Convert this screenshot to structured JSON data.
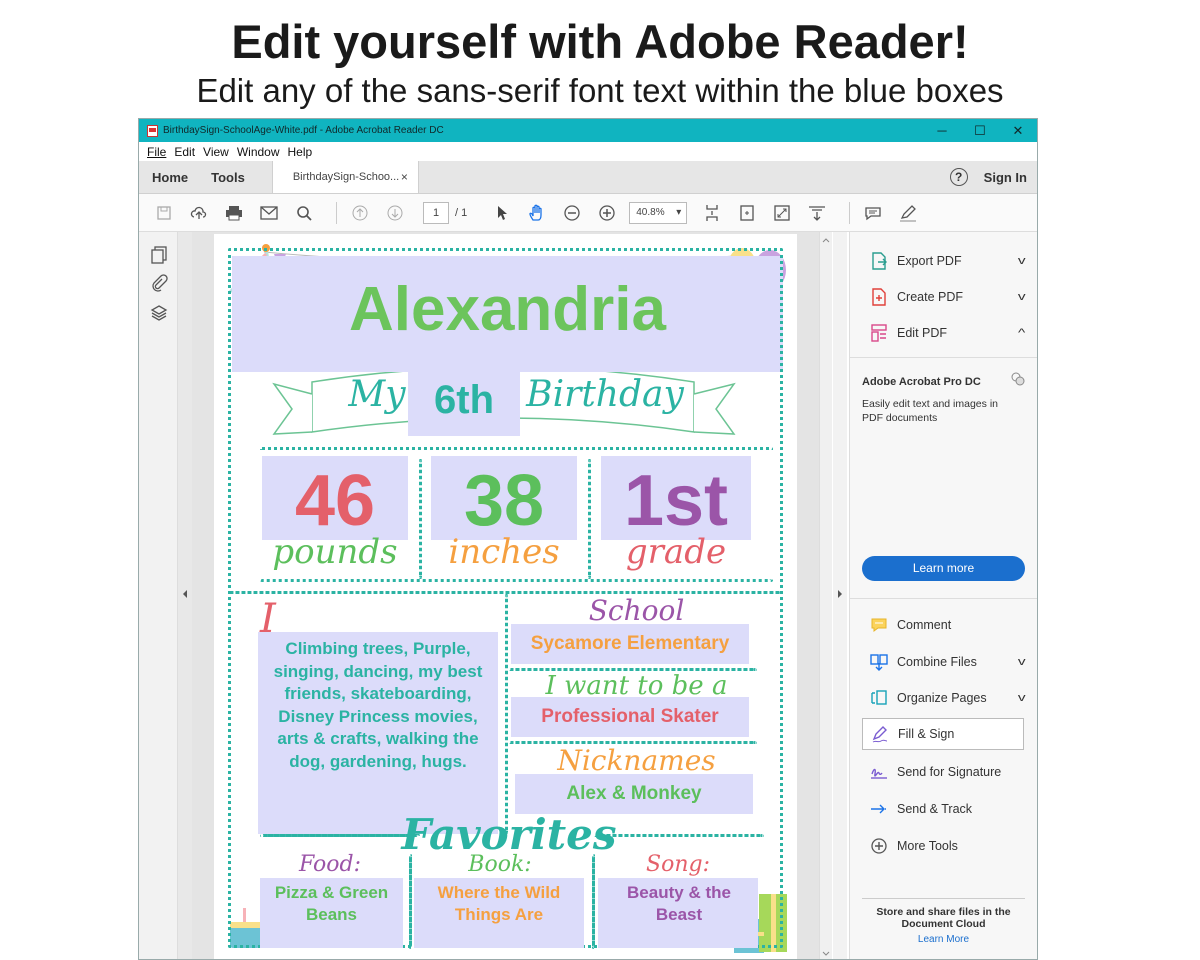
{
  "headline": "Edit yourself with Adobe Reader!",
  "subhead": "Edit any of the sans-serif font text within the blue boxes",
  "window": {
    "title": "BirthdaySign-SchoolAge-White.pdf - Adobe Acrobat Reader DC",
    "menu": [
      "File",
      "Edit",
      "View",
      "Window",
      "Help"
    ],
    "tabs": {
      "home": "Home",
      "tools": "Tools",
      "doc": "BirthdaySign-Schoo...",
      "close": "×",
      "signin": "Sign In"
    },
    "toolbar": {
      "page": "1",
      "of": "/ 1",
      "zoom": "40.8%"
    }
  },
  "right_panel": {
    "export": "Export PDF",
    "create": "Create PDF",
    "edit": "Edit PDF",
    "promo_title": "Adobe Acrobat Pro DC",
    "promo_text": "Easily edit text and images in PDF documents",
    "learn_more": "Learn more",
    "tools": [
      "Comment",
      "Combine Files",
      "Organize Pages",
      "Fill & Sign",
      "Send for Signature",
      "Send & Track",
      "More Tools"
    ],
    "store": "Store and share files in the Document Cloud",
    "store_link": "Learn More"
  },
  "poster": {
    "name": "Alexandria",
    "my": "My",
    "age": "6th",
    "birthday": "Birthday",
    "stats": [
      {
        "value": "46",
        "label": "pounds"
      },
      {
        "value": "38",
        "label": "inches"
      },
      {
        "value": "1st",
        "label": "grade"
      }
    ],
    "love_heading": "I love...",
    "love_text": "Climbing trees, Purple, singing, dancing, my best friends, skateboarding, Disney Princess movies, arts & crafts, walking the dog, gardening, hugs.",
    "school_heading": "School",
    "school": "Sycamore Elementary",
    "want_heading": "I want to be a",
    "want": "Professional Skater",
    "nick_heading": "Nicknames",
    "nick": "Alex & Monkey",
    "favorites": "Favorites",
    "food_heading": "Food:",
    "food": "Pizza & Green Beans",
    "book_heading": "Book:",
    "book": "Where the Wild Things Are",
    "song_heading": "Song:",
    "song": "Beauty & the Beast"
  },
  "colors": {
    "teal": "#10b4c0",
    "coral": "#e4606a",
    "green": "#5cbf5c",
    "purple": "#9b55a8",
    "orange": "#f5a040",
    "dots": "#2bb3a3",
    "lavender_box": "#dcdcfa"
  }
}
